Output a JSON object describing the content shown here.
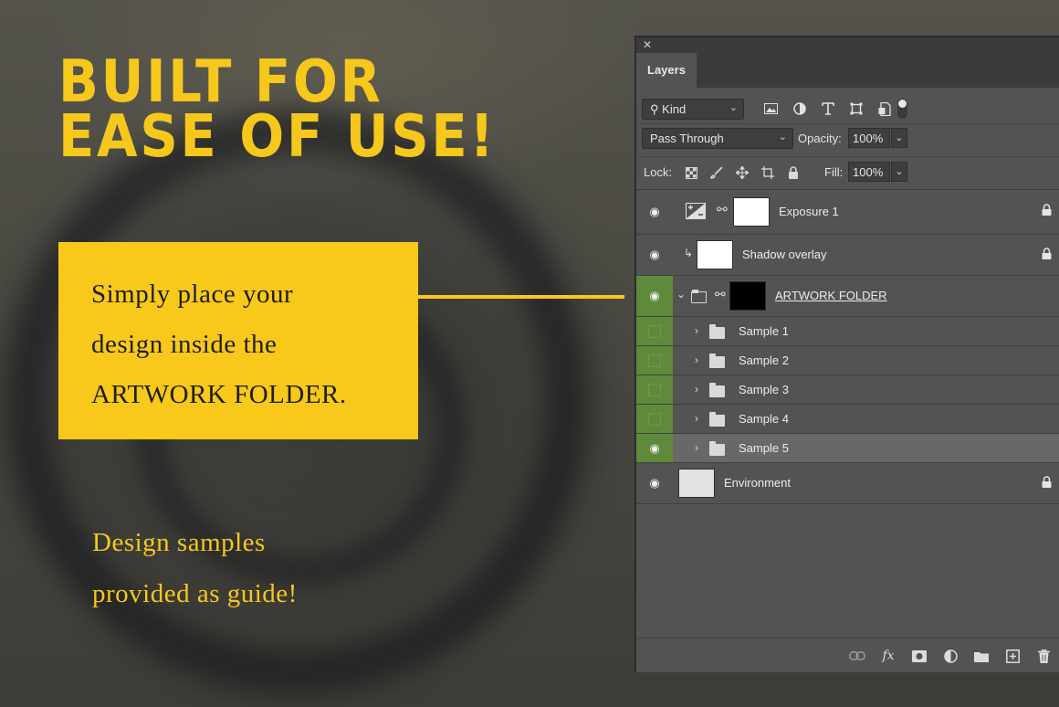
{
  "promo": {
    "headline": [
      "BUILT FOR",
      "EASE OF USE!"
    ],
    "callout_lines": [
      "Simply place your",
      "design inside the",
      "ARTWORK FOLDER."
    ],
    "note_lines": [
      "Design samples",
      "provided as guide!"
    ],
    "accent_color": "#f8c91a"
  },
  "panel": {
    "close_glyph": "✕",
    "tab_label": "Layers",
    "filter": {
      "kind_value": "Kind",
      "icons": [
        "image-filter-icon",
        "adjustment-filter-icon",
        "type-filter-icon",
        "shape-filter-icon",
        "smart-object-filter-icon"
      ]
    },
    "blend": {
      "mode": "Pass Through",
      "opacity_label": "Opacity:",
      "opacity_value": "100%"
    },
    "lock": {
      "label": "Lock:",
      "fill_label": "Fill:",
      "fill_value": "100%"
    },
    "layers": [
      {
        "name": "Exposure 1",
        "visible": true,
        "locked": true
      },
      {
        "name": "Shadow overlay",
        "visible": true,
        "locked": true
      },
      {
        "name": "ARTWORK FOLDER",
        "visible": true,
        "locked": false
      },
      {
        "name": "Sample 1",
        "visible": false,
        "locked": false
      },
      {
        "name": "Sample 2",
        "visible": false,
        "locked": false
      },
      {
        "name": "Sample 3",
        "visible": false,
        "locked": false
      },
      {
        "name": "Sample 4",
        "visible": false,
        "locked": false
      },
      {
        "name": "Sample 5",
        "visible": true,
        "locked": false,
        "selected": true
      },
      {
        "name": "Environment",
        "visible": true,
        "locked": true
      }
    ],
    "bottom_icons": [
      "link-layers-icon",
      "fx-icon",
      "add-mask-icon",
      "new-adjustment-icon",
      "new-group-icon",
      "new-layer-icon",
      "delete-layer-icon"
    ]
  }
}
